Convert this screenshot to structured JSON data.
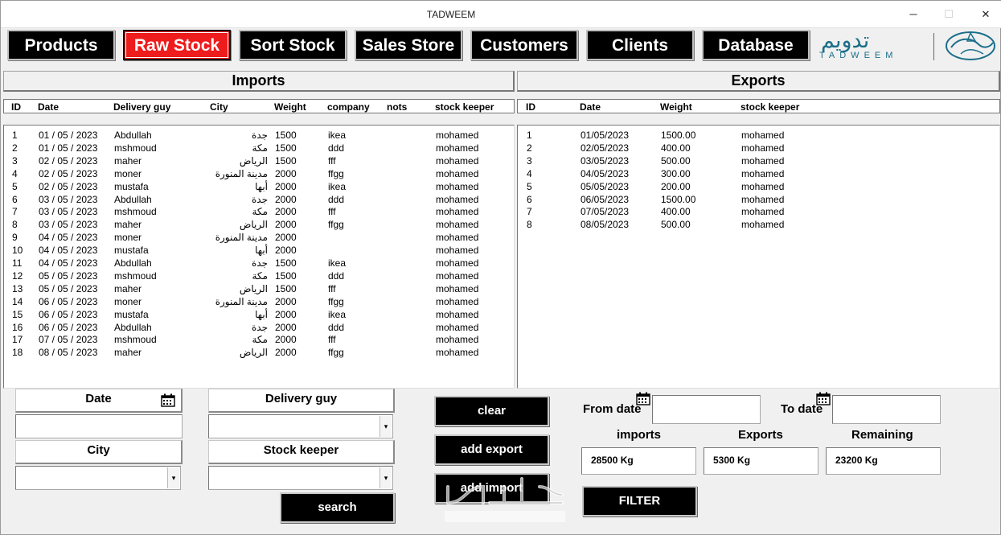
{
  "window": {
    "title": "TADWEEM",
    "minimize_glyph": "─",
    "maximize_glyph": "☐",
    "close_glyph": "✕"
  },
  "nav": {
    "products": "Products",
    "raw_stock": "Raw Stock",
    "sort_stock": "Sort Stock",
    "sales_store": "Sales Store",
    "customers": "Customers",
    "clients": "Clients",
    "database": "Database"
  },
  "logo": {
    "arabic": "تدويم",
    "english": "TADWEEM"
  },
  "imports": {
    "title": "Imports",
    "columns": [
      "ID",
      "Date",
      "Delivery guy",
      "City",
      "Weight",
      "company",
      "nots",
      "stock keeper"
    ],
    "rows": [
      [
        "1",
        "01 / 05 / 2023",
        "Abdullah",
        "جدة",
        "1500",
        "ikea",
        "",
        "mohamed"
      ],
      [
        "2",
        "01 / 05 / 2023",
        "mshmoud",
        "مكة",
        "1500",
        "ddd",
        "",
        "mohamed"
      ],
      [
        "3",
        "02 / 05 / 2023",
        "maher",
        "الرياض",
        "1500",
        "fff",
        "",
        "mohamed"
      ],
      [
        "4",
        "02 / 05 / 2023",
        "moner",
        "مدينة المنورة",
        "2000",
        "ffgg",
        "",
        "mohamed"
      ],
      [
        "5",
        "02 / 05 / 2023",
        "mustafa",
        "أبها",
        "2000",
        "ikea",
        "",
        "mohamed"
      ],
      [
        "6",
        "03 / 05 / 2023",
        "Abdullah",
        "جدة",
        "2000",
        "ddd",
        "",
        "mohamed"
      ],
      [
        "7",
        "03 / 05 / 2023",
        "mshmoud",
        "مكة",
        "2000",
        "fff",
        "",
        "mohamed"
      ],
      [
        "8",
        "03 / 05 / 2023",
        "maher",
        "الرياض",
        "2000",
        "ffgg",
        "",
        "mohamed"
      ],
      [
        "9",
        "04 / 05 / 2023",
        "moner",
        "مدينة المنورة",
        "2000",
        "",
        "",
        "mohamed"
      ],
      [
        "10",
        "04 / 05 / 2023",
        "mustafa",
        "أبها",
        "2000",
        "",
        "",
        "mohamed"
      ],
      [
        "11",
        "04 / 05 / 2023",
        "Abdullah",
        "جدة",
        "1500",
        "ikea",
        "",
        "mohamed"
      ],
      [
        "12",
        "05 / 05 / 2023",
        "mshmoud",
        "مكة",
        "1500",
        "ddd",
        "",
        "mohamed"
      ],
      [
        "13",
        "05 / 05 / 2023",
        "maher",
        "الرياض",
        "1500",
        "fff",
        "",
        "mohamed"
      ],
      [
        "14",
        "06 / 05 / 2023",
        "moner",
        "مدينة المنورة",
        "2000",
        "ffgg",
        "",
        "mohamed"
      ],
      [
        "15",
        "06 / 05 / 2023",
        "mustafa",
        "أبها",
        "2000",
        "ikea",
        "",
        "mohamed"
      ],
      [
        "16",
        "06 / 05 / 2023",
        "Abdullah",
        "جدة",
        "2000",
        "ddd",
        "",
        "mohamed"
      ],
      [
        "17",
        "07 / 05 / 2023",
        "mshmoud",
        "مكة",
        "2000",
        "fff",
        "",
        "mohamed"
      ],
      [
        "18",
        "08 / 05 / 2023",
        "maher",
        "الرياض",
        "2000",
        "ffgg",
        "",
        "mohamed"
      ]
    ]
  },
  "exports": {
    "title": "Exports",
    "columns": [
      "ID",
      "Date",
      "Weight",
      "stock keeper"
    ],
    "rows": [
      [
        "1",
        "01/05/2023",
        "1500.00",
        "mohamed"
      ],
      [
        "2",
        "02/05/2023",
        "400.00",
        "mohamed"
      ],
      [
        "3",
        "03/05/2023",
        "500.00",
        "mohamed"
      ],
      [
        "4",
        "04/05/2023",
        "300.00",
        "mohamed"
      ],
      [
        "5",
        "05/05/2023",
        "200.00",
        "mohamed"
      ],
      [
        "6",
        "06/05/2023",
        "1500.00",
        "mohamed"
      ],
      [
        "7",
        "07/05/2023",
        "400.00",
        "mohamed"
      ],
      [
        "8",
        "08/05/2023",
        "500.00",
        "mohamed"
      ]
    ]
  },
  "filters": {
    "date_label": "Date",
    "delivery_label": "Delivery guy",
    "city_label": "City",
    "keeper_label": "Stock keeper",
    "date_value": "",
    "delivery_value": "",
    "city_value": "",
    "keeper_value": "",
    "combo_arrow": "▾",
    "search_button": "search"
  },
  "actions": {
    "clear": "clear",
    "add_export": "add export",
    "add_import": "add import"
  },
  "summary": {
    "from_date_label": "From date",
    "to_date_label": "To date",
    "from_date_value": "",
    "to_date_value": "",
    "imports_label": "imports",
    "exports_label": "Exports",
    "remaining_label": "Remaining",
    "imports_value": "28500 Kg",
    "exports_value": "5300 Kg",
    "remaining_value": "23200 Kg",
    "filter_button": "FILTER"
  },
  "colors": {
    "accent_active": "#ee1c1c",
    "button_bg": "#000000",
    "logo": "#1b6f8a"
  }
}
